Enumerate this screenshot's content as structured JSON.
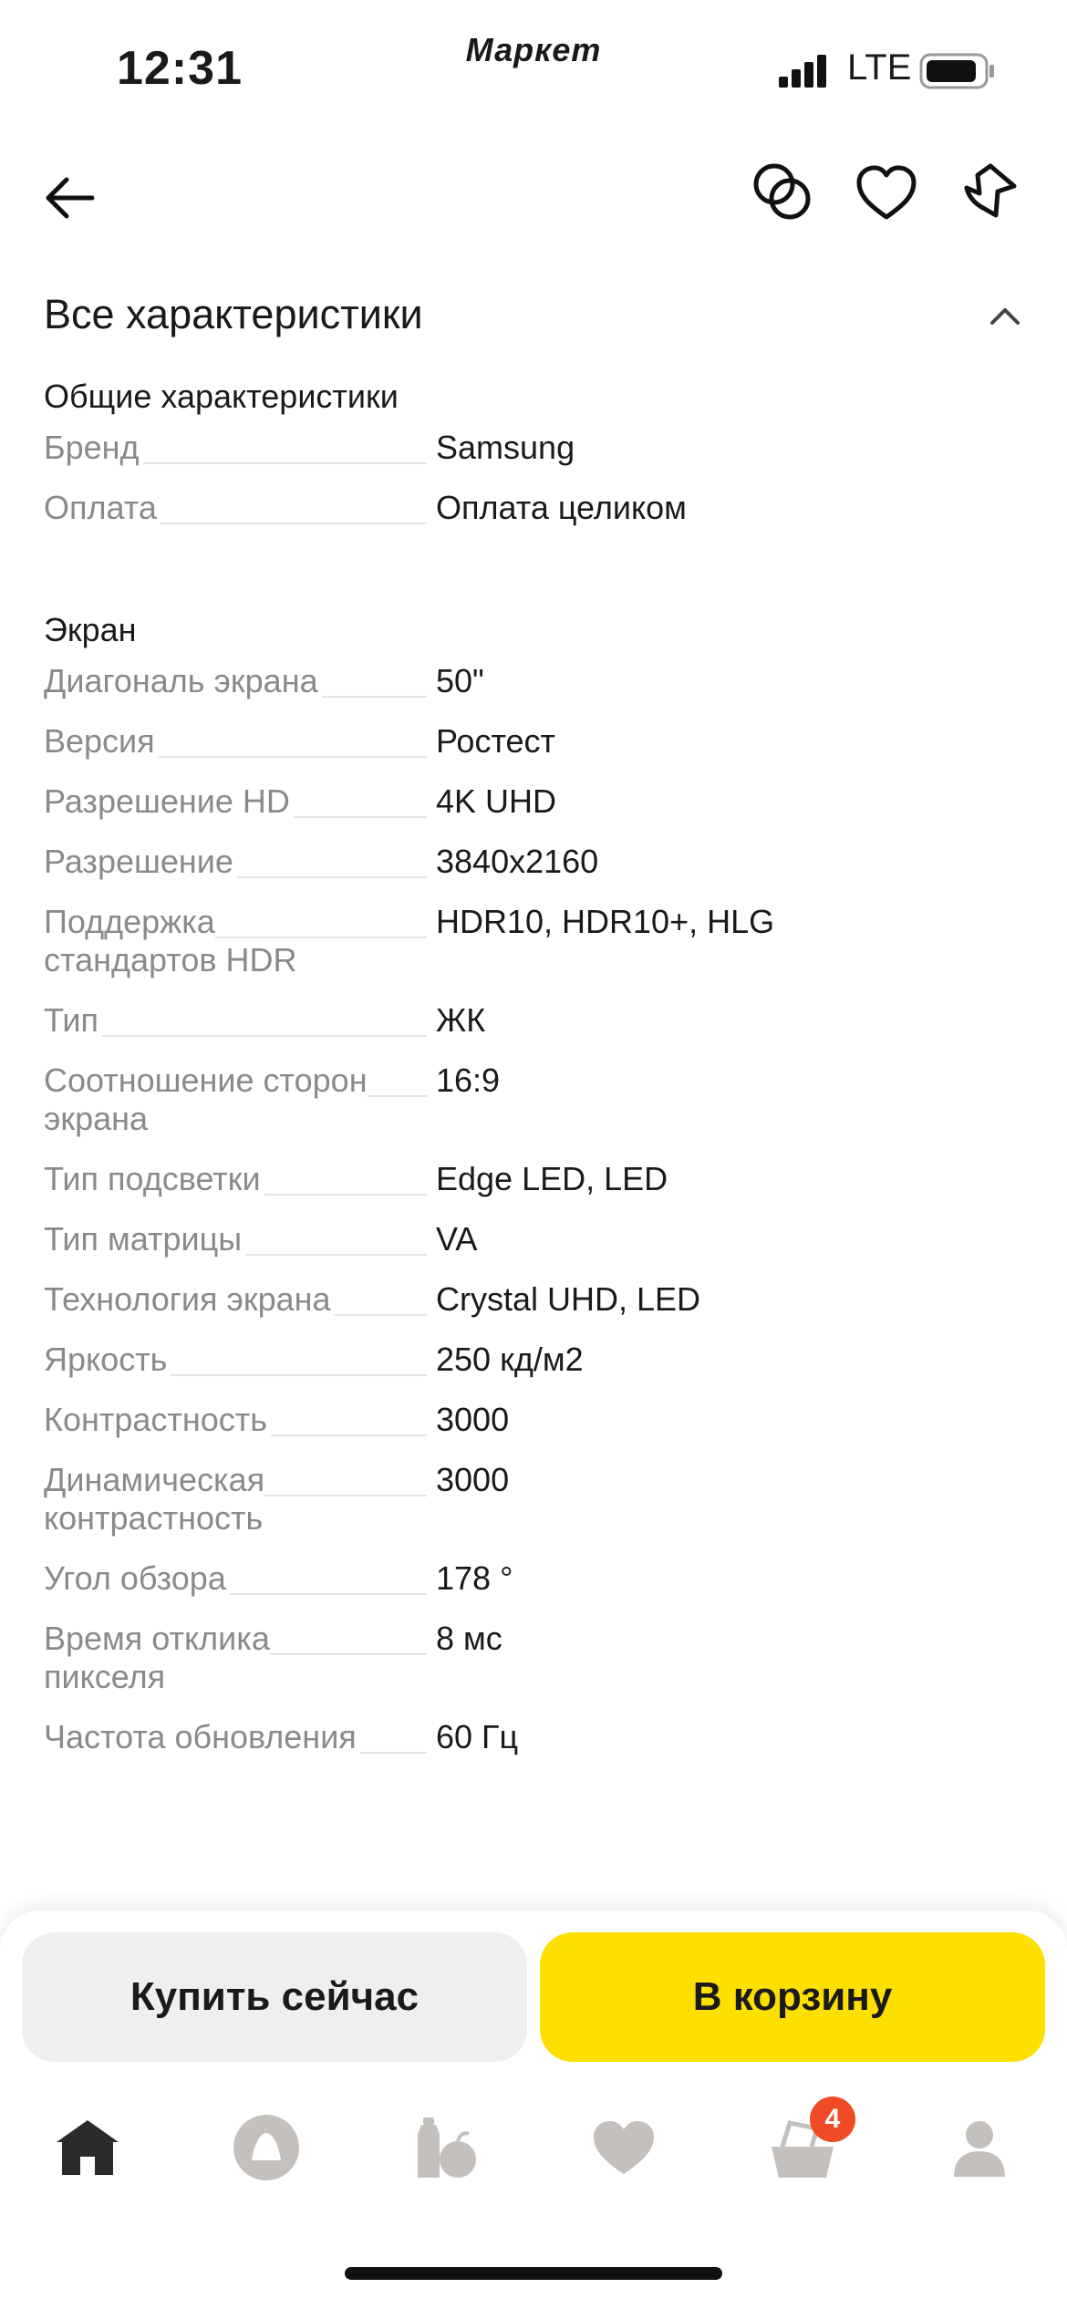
{
  "status_bar": {
    "time": "12:31",
    "app_name": "Маркет",
    "network": "LTE"
  },
  "section": {
    "title": "Все характеристики"
  },
  "groups": [
    {
      "title": "Общие характеристики",
      "rows": [
        {
          "key": "Бренд",
          "value": "Samsung"
        },
        {
          "key": "Оплата",
          "value": "Оплата целиком"
        }
      ]
    },
    {
      "title": "Экран",
      "rows": [
        {
          "key": "Диагональ экрана",
          "value": "50\""
        },
        {
          "key": "Версия",
          "value": "Ростест"
        },
        {
          "key": "Разрешение HD",
          "value": "4K UHD"
        },
        {
          "key": "Разрешение",
          "value": "3840x2160"
        },
        {
          "key": "Поддержка стандартов HDR",
          "value": "HDR10, HDR10+, HLG"
        },
        {
          "key": "Тип",
          "value": "ЖК"
        },
        {
          "key": "Соотношение сторон экрана",
          "value": "16:9"
        },
        {
          "key": "Тип подсветки",
          "value": "Edge LED, LED"
        },
        {
          "key": "Тип матрицы",
          "value": "VA"
        },
        {
          "key": "Технология экрана",
          "value": "Crystal UHD, LED"
        },
        {
          "key": "Яркость",
          "value": "250 кд/м2"
        },
        {
          "key": "Контрастность",
          "value": "3000"
        },
        {
          "key": "Динамическая контрастность",
          "value": "3000"
        },
        {
          "key": "Угол обзора",
          "value": "178 °"
        },
        {
          "key": "Время отклика пикселя",
          "value": "8 мс"
        },
        {
          "key": "Частота обновления",
          "value": "60 Гц"
        }
      ]
    }
  ],
  "actions": {
    "buy_now": "Купить сейчас",
    "add_to_cart": "В корзину"
  },
  "tab_bar": {
    "cart_badge": "4",
    "icons": [
      "home-icon",
      "alice-icon",
      "catalog-icon",
      "favorites-icon",
      "cart-icon",
      "profile-icon"
    ]
  },
  "colors": {
    "accent": "#fde000",
    "badge": "#f04b26",
    "key_text": "#8a8a8a",
    "tab_inactive": "#c4c0bd",
    "tab_active": "#2b2b2b"
  }
}
